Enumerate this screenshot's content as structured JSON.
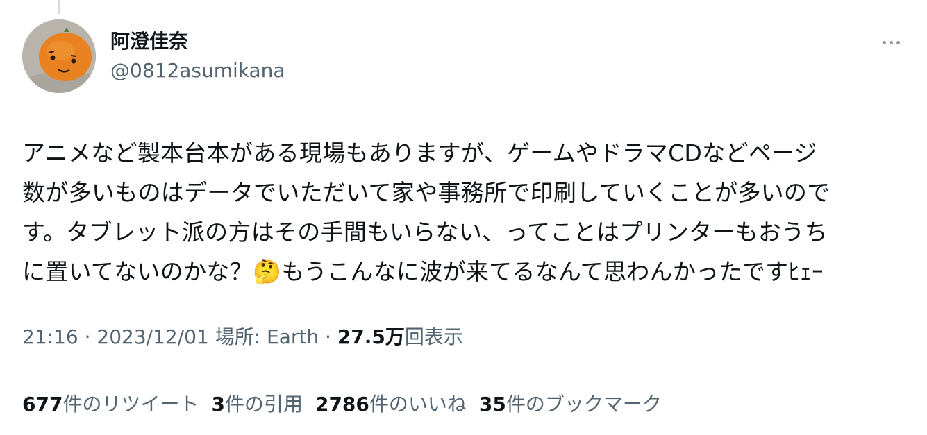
{
  "user": {
    "display_name": "阿澄佳奈",
    "handle": "@0812asumikana"
  },
  "tweet": {
    "text": "アニメなど製本台本がある現場もありますが、ゲームやドラマCDなどページ\n数が多いものはデータでいただいて家や事務所で印刷していくことが多いので\nす。タブレット派の方はその手間もいらない、ってことはプリンターもおうち\nに置いてないのかな？🤔もうこんなに波が来てるなんて思わんかったですﾋｪｰ"
  },
  "meta": {
    "time": "21:16",
    "sep1": " · ",
    "date": "2023/12/01",
    "location": " 場所: Earth",
    "sep2": " · ",
    "views_count": "27.5万",
    "views_label": "回表示"
  },
  "stats": {
    "retweets": {
      "count": "677",
      "label": "件のリツイート"
    },
    "quotes": {
      "count": "3",
      "label": "件の引用"
    },
    "likes": {
      "count": "2786",
      "label": "件のいいね"
    },
    "bookmarks": {
      "count": "35",
      "label": "件のブックマーク"
    }
  },
  "icons": {
    "more": "more-horizontal-icon",
    "avatar": "orange-avatar-image"
  },
  "colors": {
    "text_primary": "#0f1419",
    "text_secondary": "#536471",
    "divider": "#e1e8ed"
  }
}
